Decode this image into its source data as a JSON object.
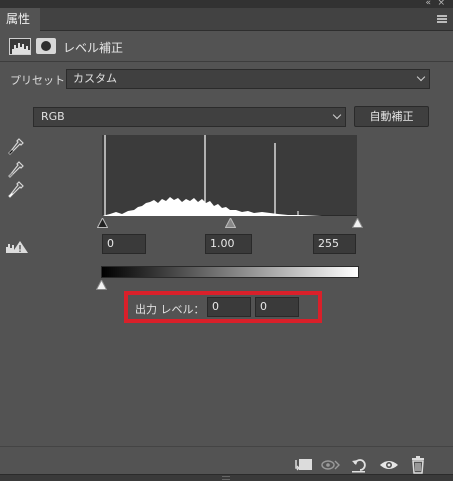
{
  "panel": {
    "tab_title": "属性",
    "adjustment_title": "レベル補正"
  },
  "preset": {
    "label": "プリセット：",
    "value": "カスタム"
  },
  "channel": {
    "value": "RGB"
  },
  "auto_button": "自動補正",
  "input_levels": {
    "black": "0",
    "gamma": "1.00",
    "white": "255"
  },
  "output_levels": {
    "label": "出力 レベル：",
    "black": "0",
    "white": "0"
  },
  "colors": {
    "panel_bg": "#535353",
    "highlight_box": "#d9202a"
  },
  "icons": {
    "collapse": "«",
    "close": "×"
  }
}
